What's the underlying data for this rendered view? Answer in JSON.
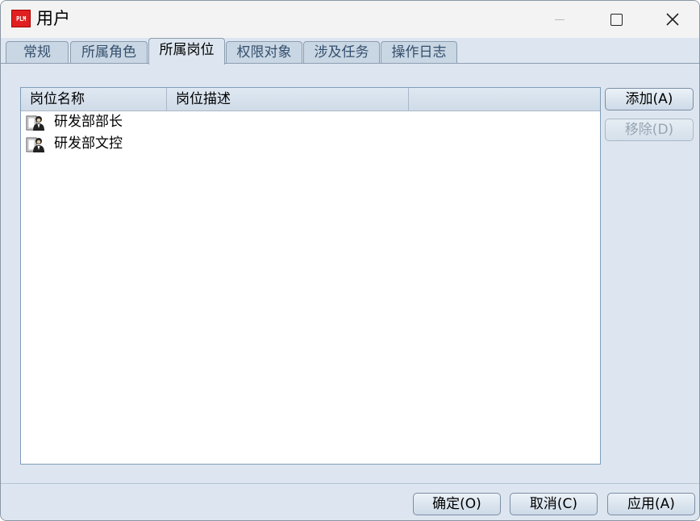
{
  "window": {
    "title": "用户",
    "icon_text": "PLM",
    "icon_color": "#e02020"
  },
  "tabs": [
    {
      "label": "常规",
      "active": false
    },
    {
      "label": "所属角色",
      "active": false
    },
    {
      "label": "所属岗位",
      "active": true
    },
    {
      "label": "权限对象",
      "active": false
    },
    {
      "label": "涉及任务",
      "active": false
    },
    {
      "label": "操作日志",
      "active": false
    }
  ],
  "list": {
    "columns": [
      "岗位名称",
      "岗位描述",
      ""
    ],
    "rows": [
      {
        "name": "研发部部长",
        "description": ""
      },
      {
        "name": "研发部文控",
        "description": ""
      }
    ]
  },
  "side_buttons": {
    "add": "添加(A)",
    "remove": "移除(D)"
  },
  "footer_buttons": {
    "ok": "确定(O)",
    "cancel": "取消(C)",
    "apply": "应用(A)"
  }
}
